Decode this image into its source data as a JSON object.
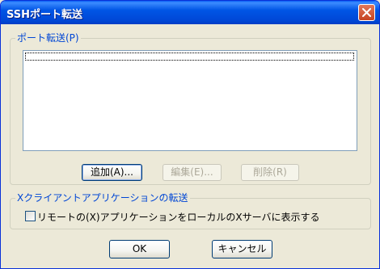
{
  "window": {
    "title": "SSHポート転送"
  },
  "port_forwarding": {
    "group_label": "ポート転送(P)",
    "list_items": [
      ""
    ],
    "add_button": "追加(A)...",
    "edit_button": "編集(E)...",
    "delete_button": "削除(R)"
  },
  "x_forwarding": {
    "group_label": "Xクライアントアプリケーションの転送",
    "checkbox_label": "リモートの(X)アプリケーションをローカルのXサーバに表示する",
    "checkbox_checked": false
  },
  "footer": {
    "ok_button": "OK",
    "cancel_button": "キャンセル"
  },
  "colors": {
    "titlebar": "#0055e5",
    "dialog_bg": "#ece9d8",
    "group_label": "#0046d5"
  }
}
